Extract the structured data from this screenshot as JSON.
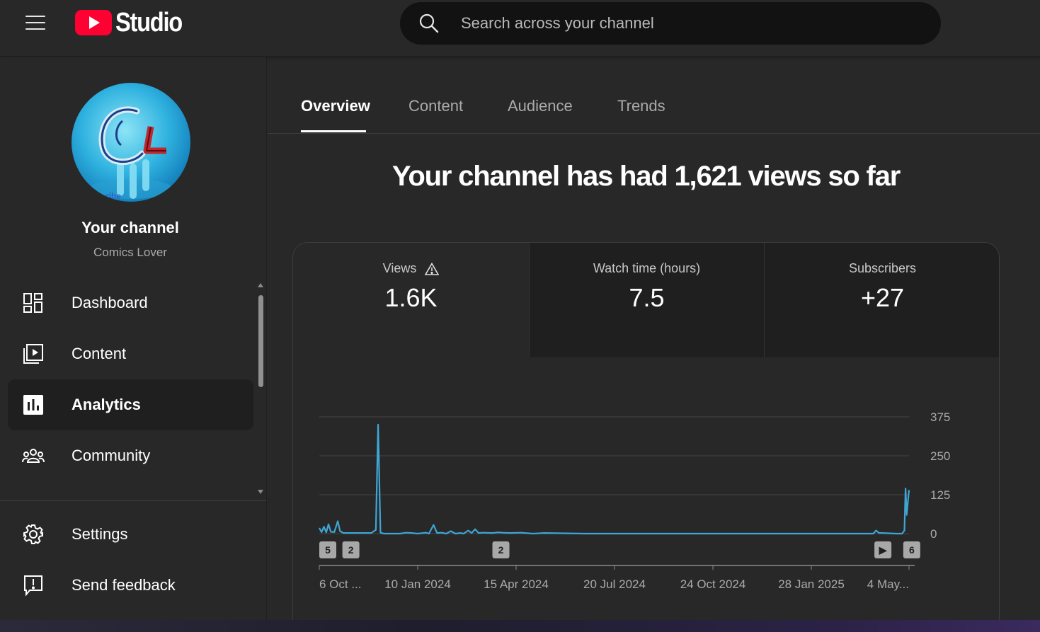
{
  "app": {
    "name": "Studio"
  },
  "search": {
    "placeholder": "Search across your channel"
  },
  "channel": {
    "title": "Your channel",
    "name": "Comics Lover",
    "avatar_text": "CL"
  },
  "sidebar": {
    "items": [
      {
        "label": "Dashboard",
        "icon": "dashboard-icon",
        "active": false
      },
      {
        "label": "Content",
        "icon": "content-icon",
        "active": false
      },
      {
        "label": "Analytics",
        "icon": "analytics-icon",
        "active": true
      },
      {
        "label": "Community",
        "icon": "community-icon",
        "active": false
      }
    ],
    "bottom_items": [
      {
        "label": "Settings",
        "icon": "gear-icon"
      },
      {
        "label": "Send feedback",
        "icon": "feedback-icon"
      }
    ]
  },
  "tabs": [
    {
      "label": "Overview",
      "active": true
    },
    {
      "label": "Content",
      "active": false
    },
    {
      "label": "Audience",
      "active": false
    },
    {
      "label": "Trends",
      "active": false
    }
  ],
  "headline": "Your channel has had 1,621 views so far",
  "metrics": [
    {
      "label": "Views",
      "value": "1.6K",
      "warning": true
    },
    {
      "label": "Watch time (hours)",
      "value": "7.5",
      "warning": false
    },
    {
      "label": "Subscribers",
      "value": "+27",
      "warning": false
    }
  ],
  "colors": {
    "accent_line": "#3ea6d6",
    "brand_red": "#ff0033"
  },
  "chart_data": {
    "type": "line",
    "series": [
      {
        "values": [
          [
            0,
            18
          ],
          [
            4,
            5
          ],
          [
            8,
            22
          ],
          [
            12,
            4
          ],
          [
            16,
            30
          ],
          [
            20,
            6
          ],
          [
            26,
            5
          ],
          [
            32,
            40
          ],
          [
            36,
            8
          ],
          [
            42,
            2
          ],
          [
            90,
            2
          ],
          [
            98,
            12
          ],
          [
            102,
            350
          ],
          [
            106,
            3
          ],
          [
            112,
            0
          ],
          [
            140,
            0
          ],
          [
            150,
            3
          ],
          [
            160,
            2
          ],
          [
            170,
            0
          ],
          [
            185,
            3
          ],
          [
            190,
            0
          ],
          [
            198,
            28
          ],
          [
            204,
            2
          ],
          [
            212,
            3
          ],
          [
            220,
            0
          ],
          [
            228,
            8
          ],
          [
            236,
            0
          ],
          [
            244,
            2
          ],
          [
            250,
            0
          ],
          [
            258,
            10
          ],
          [
            264,
            2
          ],
          [
            270,
            14
          ],
          [
            276,
            2
          ],
          [
            284,
            3
          ],
          [
            300,
            2
          ],
          [
            310,
            4
          ],
          [
            318,
            3
          ],
          [
            330,
            2
          ],
          [
            350,
            3
          ],
          [
            370,
            0
          ],
          [
            390,
            2
          ],
          [
            460,
            0
          ],
          [
            520,
            0
          ],
          [
            600,
            0
          ],
          [
            680,
            0
          ],
          [
            760,
            0
          ],
          [
            840,
            0
          ],
          [
            900,
            0
          ],
          [
            940,
            0
          ],
          [
            960,
            0
          ],
          [
            965,
            10
          ],
          [
            970,
            2
          ],
          [
            975,
            2
          ],
          [
            1000,
            0
          ],
          [
            1010,
            0
          ],
          [
            1014,
            10
          ],
          [
            1016,
            145
          ],
          [
            1018,
            60
          ],
          [
            1022,
            140
          ]
        ]
      }
    ],
    "ylim": [
      0,
      375
    ],
    "yticks": [
      "375",
      "250",
      "125",
      "0"
    ],
    "xticks": [
      "6 Oct ...",
      "10 Jan 2024",
      "15 Apr 2024",
      "20 Jul 2024",
      "24 Oct 2024",
      "28 Jan 2025",
      "4 May..."
    ],
    "markers": [
      {
        "label": "5",
        "x": 0
      },
      {
        "label": "2",
        "x": 40
      },
      {
        "label": "2",
        "x": 300
      },
      {
        "label": "▶",
        "x": 962
      },
      {
        "label": "6",
        "x": 1012
      }
    ],
    "grid": true,
    "x_domain": [
      0,
      1022
    ]
  }
}
